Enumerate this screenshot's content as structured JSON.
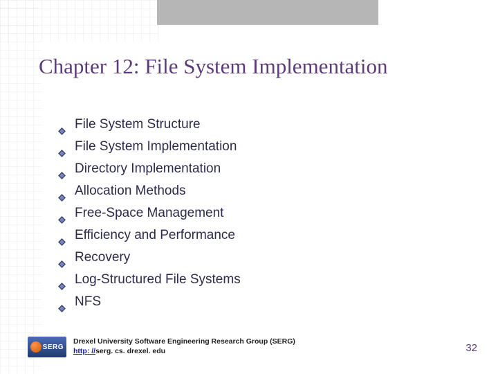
{
  "title": "Chapter 12: File System Implementation",
  "items": [
    "File System Structure",
    "File System Implementation",
    "Directory Implementation",
    "Allocation Methods",
    "Free-Space Management",
    "Efficiency and Performance",
    "Recovery",
    "Log-Structured File Systems",
    "NFS"
  ],
  "footer": {
    "org": "Drexel University Software Engineering Research Group (SERG)",
    "link_prefix": "http: //",
    "link_host": "serg. cs. drexel. edu",
    "logo_text": "SERG"
  },
  "page_number": "32"
}
